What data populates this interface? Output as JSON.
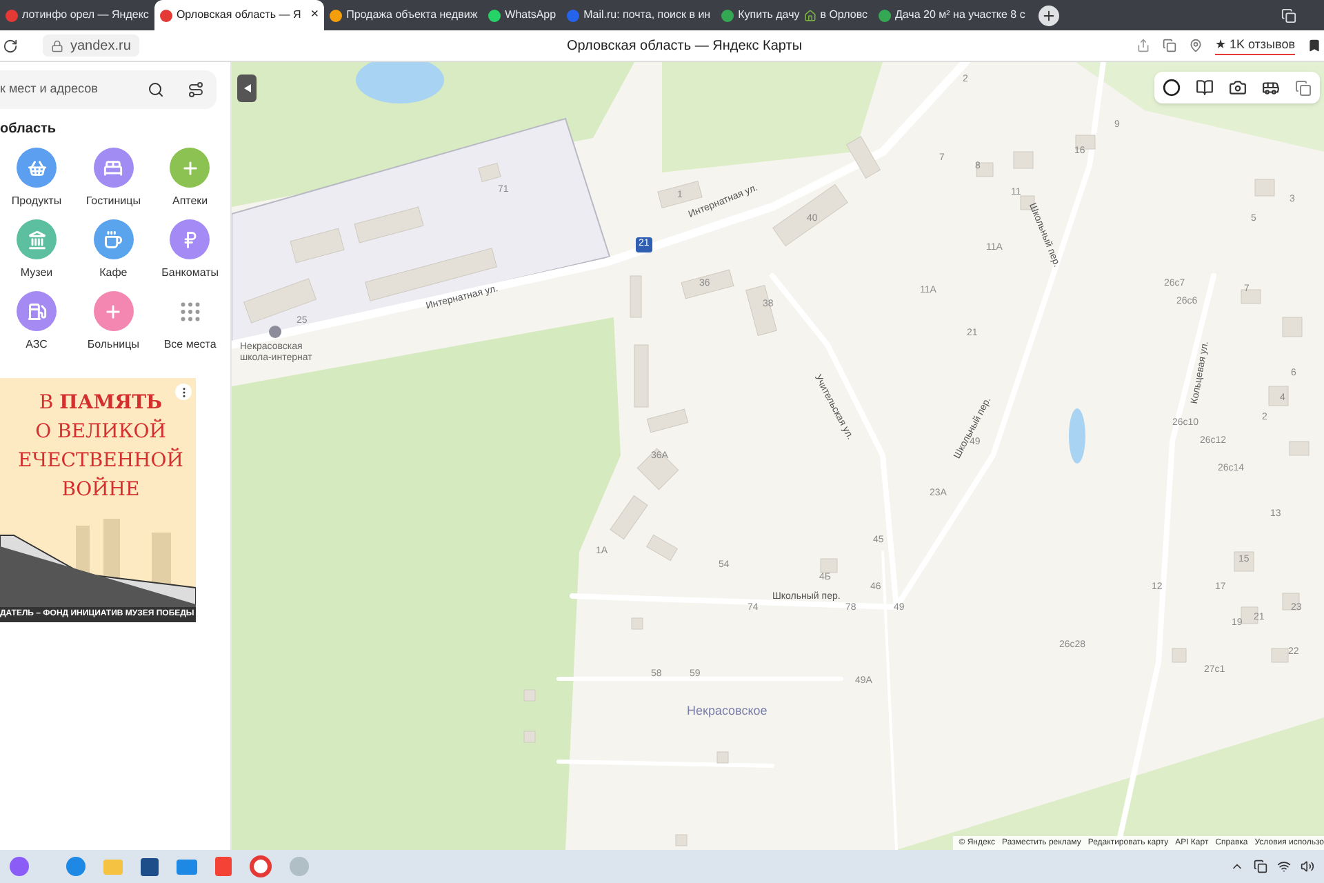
{
  "tabs": [
    {
      "title": "лотинфо орел — Яндекс",
      "selected": false
    },
    {
      "title": "Орловская область — Я",
      "selected": true,
      "close": "×"
    },
    {
      "title": "Продажа объекта недвиж",
      "selected": false
    },
    {
      "title": "WhatsApp",
      "selected": false
    },
    {
      "title": "Mail.ru: почта, поиск в ин",
      "selected": false
    },
    {
      "title": "Купить дачу",
      "title_2": "в Орловс",
      "selected": false
    },
    {
      "title": "Дача 20 м² на участке 8 с",
      "selected": false
    }
  ],
  "address_bar": {
    "domain": "yandex.ru",
    "page_title": "Орловская область — Яндекс Карты",
    "reviews": "★ 1K отзывов"
  },
  "sidebar": {
    "search": {
      "placeholder": "к мест и адресов"
    },
    "region": "область",
    "categories": [
      {
        "label": "Продукты",
        "kind": "circle",
        "color": "#5c9ff0"
      },
      {
        "label": "Гостиницы",
        "kind": "circle",
        "color": "#a08cf2"
      },
      {
        "label": "Аптеки",
        "kind": "circle",
        "color": "#8cc251"
      },
      {
        "label": "Музеи",
        "kind": "circle",
        "color": "#5cbf9f"
      },
      {
        "label": "Кафе",
        "kind": "circle",
        "color": "#5aa4ee"
      },
      {
        "label": "Банкоматы",
        "kind": "circle",
        "color": "#a38af4"
      },
      {
        "label": "АЗС",
        "kind": "circle",
        "color": "#a48af2"
      },
      {
        "label": "Больницы",
        "kind": "circle",
        "color": "#f487b2"
      },
      {
        "label": "Все места",
        "kind": "more"
      }
    ],
    "banner": {
      "lines": [
        "В **ПАМЯТЬ**",
        "О ВЕЛИКОЙ",
        "ЕЧЕСТВЕННОЙ",
        "ВОЙНЕ"
      ],
      "footer": "ДАТЕЛЬ – ФОНД ИНИЦИАТИВ МУЗЕЯ ПОБЕДЫ"
    }
  },
  "map": {
    "route_shield": "21",
    "labels": [
      {
        "text": "Интернатная ул.",
        "kind": "street"
      },
      {
        "text": "Интернатная ул.",
        "kind": "street"
      },
      {
        "text": "Учительская ул.",
        "kind": "street"
      },
      {
        "text": "Школьный пер.",
        "kind": "street"
      },
      {
        "text": "Школьный пер.",
        "kind": "street"
      },
      {
        "text": "Школьный пер.",
        "kind": "street"
      },
      {
        "text": "Кольцевая ул.",
        "kind": "street"
      },
      {
        "text": "Некрасовское",
        "kind": "place"
      },
      {
        "text": "Некрасовская школа-интернат",
        "kind": "poi"
      },
      {
        "text": "2",
        "kind": "house"
      },
      {
        "text": "9",
        "kind": "house"
      },
      {
        "text": "16",
        "kind": "house"
      },
      {
        "text": "7",
        "kind": "house"
      },
      {
        "text": "8",
        "kind": "house"
      },
      {
        "text": "71",
        "kind": "house"
      },
      {
        "text": "11",
        "kind": "house"
      },
      {
        "text": "1",
        "kind": "house"
      },
      {
        "text": "3",
        "kind": "house"
      },
      {
        "text": "40",
        "kind": "house"
      },
      {
        "text": "5",
        "kind": "house"
      },
      {
        "text": "11А",
        "kind": "house"
      },
      {
        "text": "36",
        "kind": "house"
      },
      {
        "text": "26с7",
        "kind": "house"
      },
      {
        "text": "7",
        "kind": "house"
      },
      {
        "text": "11А",
        "kind": "house"
      },
      {
        "text": "26с6",
        "kind": "house"
      },
      {
        "text": "38",
        "kind": "house"
      },
      {
        "text": "25",
        "kind": "house"
      },
      {
        "text": "21",
        "kind": "house"
      },
      {
        "text": "6",
        "kind": "house"
      },
      {
        "text": "4",
        "kind": "house"
      },
      {
        "text": "2",
        "kind": "house"
      },
      {
        "text": "26с10",
        "kind": "house"
      },
      {
        "text": "26с12",
        "kind": "house"
      },
      {
        "text": "49",
        "kind": "house"
      },
      {
        "text": "36А",
        "kind": "house"
      },
      {
        "text": "26с14",
        "kind": "house"
      },
      {
        "text": "23А",
        "kind": "house"
      },
      {
        "text": "13",
        "kind": "house"
      },
      {
        "text": "45",
        "kind": "house"
      },
      {
        "text": "1А",
        "kind": "house"
      },
      {
        "text": "15",
        "kind": "house"
      },
      {
        "text": "54",
        "kind": "house"
      },
      {
        "text": "4Б",
        "kind": "house"
      },
      {
        "text": "46",
        "kind": "house"
      },
      {
        "text": "12",
        "kind": "house"
      },
      {
        "text": "17",
        "kind": "house"
      },
      {
        "text": "74",
        "kind": "house"
      },
      {
        "text": "78",
        "kind": "house"
      },
      {
        "text": "49",
        "kind": "house"
      },
      {
        "text": "23",
        "kind": "house"
      },
      {
        "text": "21",
        "kind": "house"
      },
      {
        "text": "19",
        "kind": "house"
      },
      {
        "text": "26с28",
        "kind": "house"
      },
      {
        "text": "22",
        "kind": "house"
      },
      {
        "text": "27с1",
        "kind": "house"
      },
      {
        "text": "58",
        "kind": "house"
      },
      {
        "text": "59",
        "kind": "house"
      },
      {
        "text": "49А",
        "kind": "house"
      }
    ],
    "attribution": [
      "© Яндекс",
      "Разместить рекламу",
      "Редактировать карту",
      "API Карт",
      "Справка",
      "Условия использо"
    ]
  }
}
